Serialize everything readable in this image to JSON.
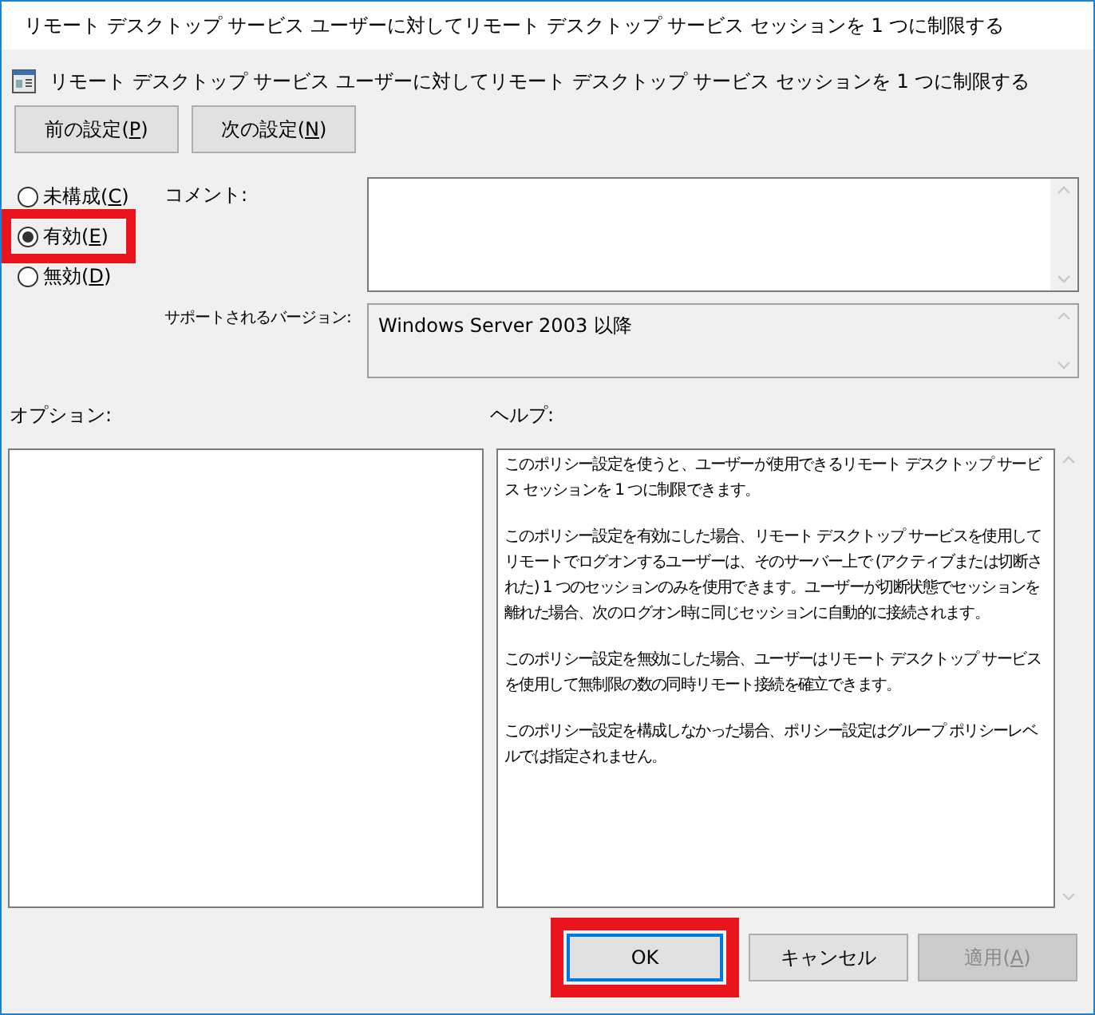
{
  "window": {
    "title": "リモート デスクトップ サービス ユーザーに対してリモート デスクトップ サービス セッションを 1 つに制限する"
  },
  "header": {
    "title": "リモート デスクトップ サービス ユーザーに対してリモート デスクトップ サービス セッションを 1 つに制限する"
  },
  "nav_buttons": [
    {
      "label": {
        "before": "前の設定(",
        "key": "P",
        "after": ")"
      }
    },
    {
      "label": {
        "before": "次の設定(",
        "key": "N",
        "after": ")"
      }
    }
  ],
  "state_options": [
    {
      "label": {
        "before": "未構成(",
        "key": "C",
        "after": ")"
      },
      "selected": false,
      "highlighted": false
    },
    {
      "label": {
        "before": "有効(",
        "key": "E",
        "after": ")"
      },
      "selected": true,
      "highlighted": true
    },
    {
      "label": {
        "before": "無効(",
        "key": "D",
        "after": ")"
      },
      "selected": false,
      "highlighted": false
    }
  ],
  "comment": {
    "label": "コメント:"
  },
  "supported": {
    "label": "サポートされるバージョン:",
    "value": "Windows Server 2003 以降"
  },
  "options": {
    "label": "オプション:"
  },
  "help": {
    "label": "ヘルプ:",
    "paragraphs": [
      "このポリシー設定を使うと、ユーザーが使用できるリモート デスクトップ サービス セッションを 1 つに制限できます。",
      "このポリシー設定を有効にした場合、リモート デスクトップ サービスを使用してリモートでログオンするユーザーは、そのサーバー上で (アクティブまたは切断された) 1 つのセッションのみを使用できます。ユーザーが切断状態でセッションを離れた場合、次のログオン時に同じセッションに自動的に接続されます。",
      "このポリシー設定を無効にした場合、ユーザーはリモート デスクトップ サービスを使用して無制限の数の同時リモート接続を確立できます。",
      "このポリシー設定を構成しなかった場合、ポリシー設定はグループ ポリシーレベルでは指定されません。"
    ]
  },
  "footer_buttons": [
    {
      "kind": "default",
      "label": {
        "before": "OK"
      },
      "disabled": false,
      "highlighted": true
    },
    {
      "kind": "normal",
      "label": {
        "before": "キャンセル"
      },
      "disabled": false,
      "highlighted": false
    },
    {
      "kind": "normal",
      "label": {
        "before": "適用(",
        "key": "A",
        "after": ")"
      },
      "disabled": true,
      "highlighted": false
    }
  ]
}
